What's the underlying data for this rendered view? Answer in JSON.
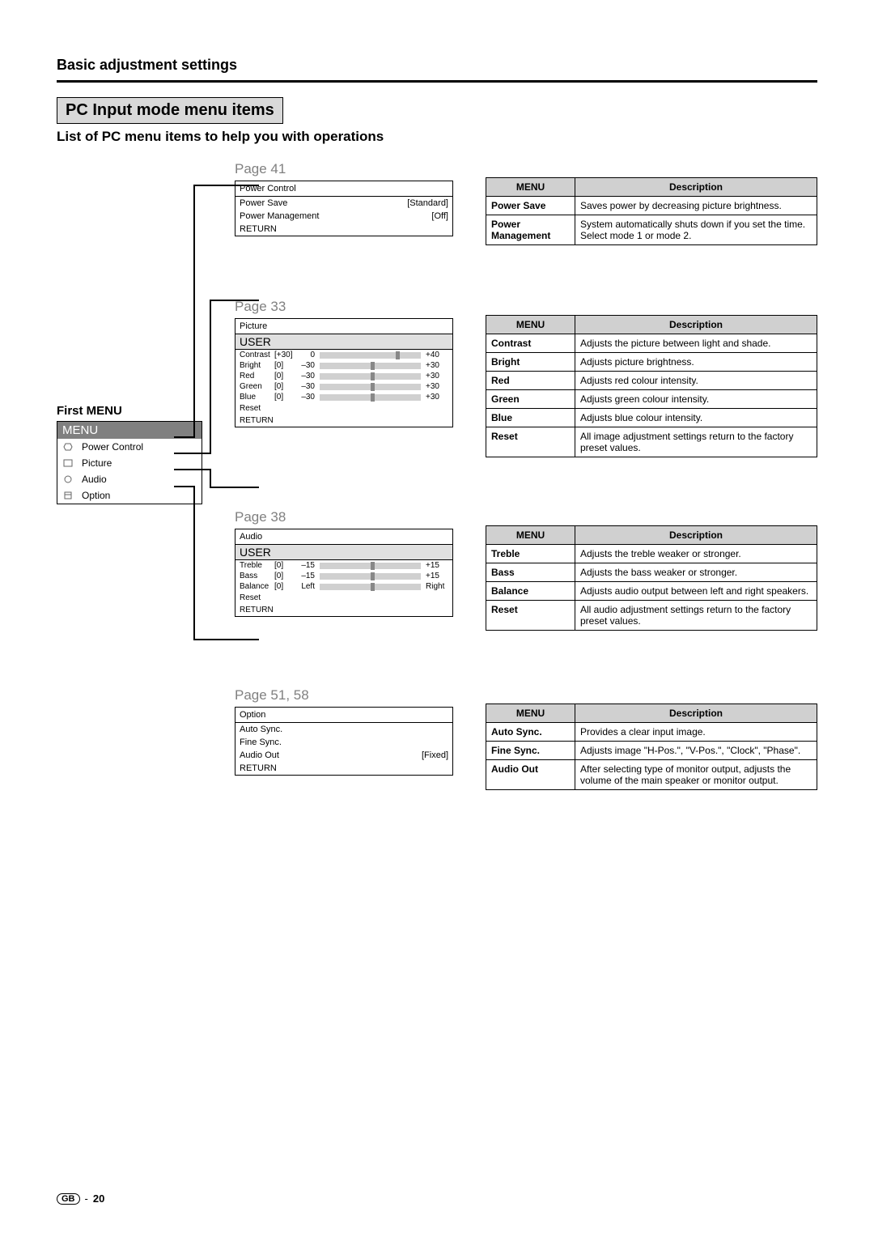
{
  "section_title": "Basic adjustment settings",
  "heading": "PC Input mode menu items",
  "subheading": "List of PC menu items to help you with operations",
  "first_menu": {
    "label": "First MENU",
    "header": "MENU",
    "items": [
      "Power Control",
      "Picture",
      "Audio",
      "Option"
    ]
  },
  "blocks": [
    {
      "page": "Page 41",
      "menu": {
        "title": "Power Control",
        "rows": [
          {
            "label": "Power Save",
            "value": "[Standard]"
          },
          {
            "label": "Power Management",
            "value": "[Off]"
          }
        ],
        "return": "RETURN"
      },
      "desc": [
        {
          "menu": "Power Save",
          "text": "Saves power by decreasing picture brightness."
        },
        {
          "menu": "Power Management",
          "text": "System automatically shuts down if you set the time. Select mode 1 or mode 2."
        }
      ]
    },
    {
      "page": "Page 33",
      "menu": {
        "title": "Picture",
        "user": "USER",
        "sliders": [
          {
            "label": "Contrast",
            "val": "[+30]",
            "min": "0",
            "max": "+40",
            "pos": 75
          },
          {
            "label": "Bright",
            "val": "[0]",
            "min": "–30",
            "max": "+30",
            "pos": 50
          },
          {
            "label": "Red",
            "val": "[0]",
            "min": "–30",
            "max": "+30",
            "pos": 50
          },
          {
            "label": "Green",
            "val": "[0]",
            "min": "–30",
            "max": "+30",
            "pos": 50
          },
          {
            "label": "Blue",
            "val": "[0]",
            "min": "–30",
            "max": "+30",
            "pos": 50
          }
        ],
        "extras": [
          "Reset",
          "RETURN"
        ]
      },
      "desc": [
        {
          "menu": "Contrast",
          "text": "Adjusts the picture between light and shade."
        },
        {
          "menu": "Bright",
          "text": "Adjusts picture brightness."
        },
        {
          "menu": "Red",
          "text": "Adjusts red colour intensity."
        },
        {
          "menu": "Green",
          "text": "Adjusts green colour intensity."
        },
        {
          "menu": "Blue",
          "text": "Adjusts blue colour intensity."
        },
        {
          "menu": "Reset",
          "text": "All image adjustment settings return to the factory preset values."
        }
      ]
    },
    {
      "page": "Page 38",
      "menu": {
        "title": "Audio",
        "user": "USER",
        "sliders": [
          {
            "label": "Treble",
            "val": "[0]",
            "min": "–15",
            "max": "+15",
            "pos": 50
          },
          {
            "label": "Bass",
            "val": "[0]",
            "min": "–15",
            "max": "+15",
            "pos": 50
          },
          {
            "label": "Balance",
            "val": "[0]",
            "min": "Left",
            "max": "Right",
            "pos": 50
          }
        ],
        "extras": [
          "Reset",
          "RETURN"
        ]
      },
      "desc": [
        {
          "menu": "Treble",
          "text": "Adjusts the treble weaker or stronger."
        },
        {
          "menu": "Bass",
          "text": "Adjusts the bass weaker or stronger."
        },
        {
          "menu": "Balance",
          "text": "Adjusts audio output between left and right speakers."
        },
        {
          "menu": "Reset",
          "text": "All audio adjustment settings return to the factory preset values."
        }
      ]
    },
    {
      "page": "Page 51, 58",
      "menu": {
        "title": "Option",
        "rows": [
          {
            "label": "Auto Sync.",
            "value": ""
          },
          {
            "label": "Fine Sync.",
            "value": ""
          },
          {
            "label": "Audio Out",
            "value": "[Fixed]"
          }
        ],
        "return": "RETURN"
      },
      "desc": [
        {
          "menu": "Auto Sync.",
          "text": "Provides a clear input image."
        },
        {
          "menu": "Fine Sync.",
          "text": "Adjusts image \"H-Pos.\", \"V-Pos.\", \"Clock\", \"Phase\"."
        },
        {
          "menu": "Audio Out",
          "text": "After selecting type of monitor output, adjusts the volume of the main speaker or monitor output."
        }
      ]
    }
  ],
  "desc_headers": {
    "menu": "MENU",
    "desc": "Description"
  },
  "footer": {
    "gb": "GB",
    "page": "20"
  }
}
